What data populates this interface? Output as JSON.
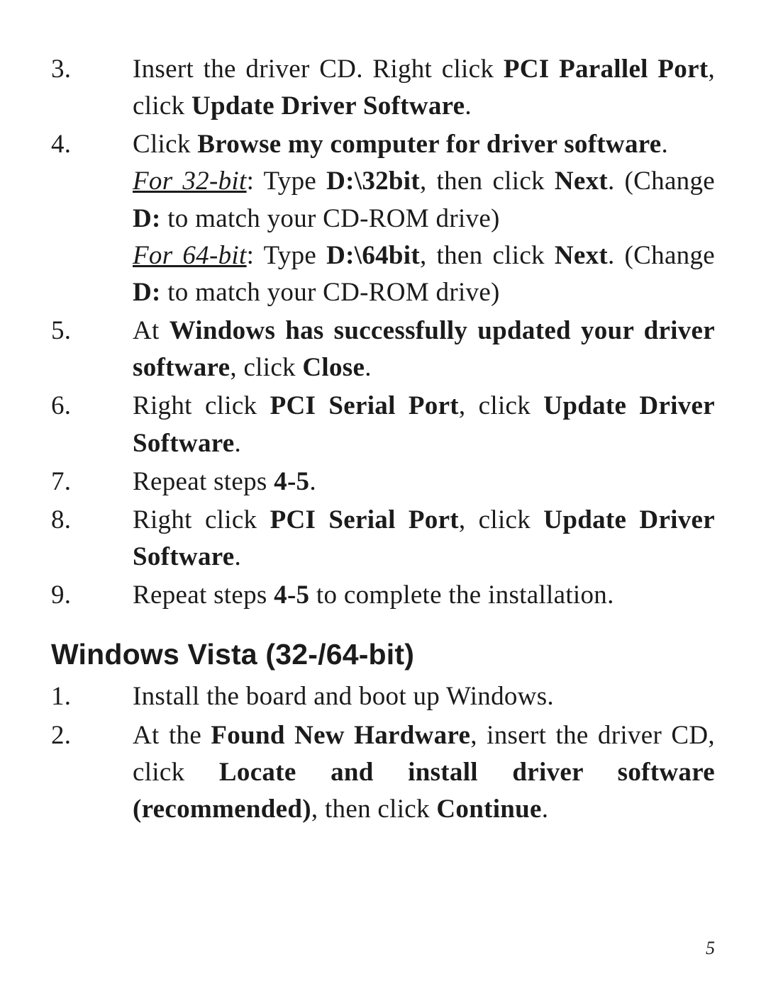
{
  "list1": {
    "s3": {
      "num": "3.",
      "t1": "Insert the driver CD.  Right click ",
      "b1": "PCI Parallel Port",
      "t2": ", click ",
      "b2": "Update Driver Software",
      "t3": "."
    },
    "s4": {
      "num": "4.",
      "l1_t1": "Click ",
      "l1_b1": "Browse my computer for driver software",
      "l1_t2": ".",
      "l2_iu1": "For 32-bit",
      "l2_t1": ": Type ",
      "l2_b1": "D:\\32bit",
      "l2_t2": ", then click ",
      "l2_b2": "Next",
      "l2_t3": ". (Change ",
      "l2_b3": "D:",
      "l2_t4": " to match your CD-ROM drive)",
      "l3_iu1": "For 64-bit",
      "l3_t1": ":  Type ",
      "l3_b1": "D:\\64bit",
      "l3_t2": ", then click ",
      "l3_b2": "Next",
      "l3_t3": ". (Change ",
      "l3_b3": "D:",
      "l3_t4": " to match your CD-ROM drive)"
    },
    "s5": {
      "num": "5.",
      "t1": "At ",
      "b1": "Windows has successfully updated your driver software",
      "t2": ", click ",
      "b2": "Close",
      "t3": "."
    },
    "s6": {
      "num": "6.",
      "t1": "Right click ",
      "b1": "PCI Serial Port",
      "t2": ", click ",
      "b2": "Update Driver Software",
      "t3": "."
    },
    "s7": {
      "num": "7.",
      "t1": "Repeat steps ",
      "b1": "4-5",
      "t2": "."
    },
    "s8": {
      "num": "8.",
      "t1": "Right click ",
      "b1": "PCI Serial Port",
      "t2": ", click ",
      "b2": "Update Driver Software",
      "t3": "."
    },
    "s9": {
      "num": "9.",
      "t1": "Repeat steps ",
      "b1": "4-5",
      "t2": " to complete the installation."
    }
  },
  "heading": "Windows Vista (32-/64-bit)",
  "list2": {
    "s1": {
      "num": "1.",
      "t1": "Install the board and boot up Windows."
    },
    "s2": {
      "num": "2.",
      "t1": "At the ",
      "b1": "Found New Hardware",
      "t2": ", insert the driver CD, click ",
      "b2": "Locate and install driver software (recommended)",
      "t3": ", then click ",
      "b3": "Continue",
      "t4": "."
    }
  },
  "page_number": "5"
}
